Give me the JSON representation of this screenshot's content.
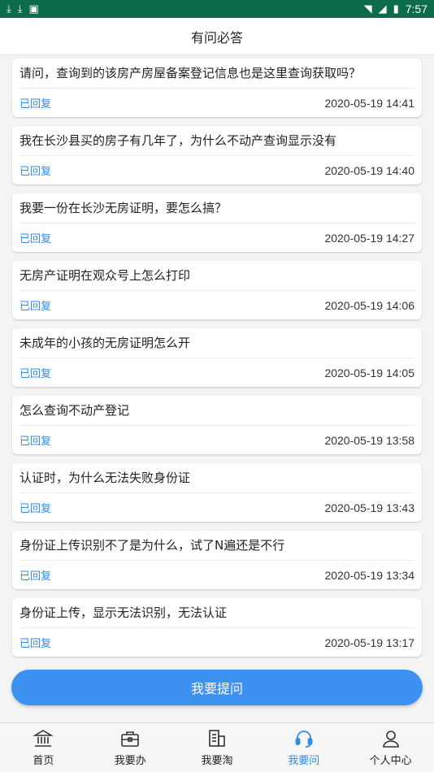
{
  "status_bar": {
    "time": "7:57"
  },
  "header": {
    "title": "有问必答"
  },
  "questions": [
    {
      "question": "请问，查询到的该房产房屋备案登记信息也是这里查询获取吗？",
      "status": "已回复",
      "time": "2020-05-19 14:41"
    },
    {
      "question": "我在长沙县买的房子有几年了，为什么不动产查询显示没有",
      "status": "已回复",
      "time": "2020-05-19 14:40"
    },
    {
      "question": "我要一份在长沙无房证明，要怎么搞？",
      "status": "已回复",
      "time": "2020-05-19 14:27"
    },
    {
      "question": "无房产证明在观众号上怎么打印",
      "status": "已回复",
      "time": "2020-05-19 14:06"
    },
    {
      "question": "未成年的小孩的无房证明怎么开",
      "status": "已回复",
      "time": "2020-05-19 14:05"
    },
    {
      "question": "怎么查询不动产登记",
      "status": "已回复",
      "time": "2020-05-19 13:58"
    },
    {
      "question": "认证时，为什么无法失败身份证",
      "status": "已回复",
      "time": "2020-05-19 13:43"
    },
    {
      "question": "身份证上传识别不了是为什么，试了N遍还是不行",
      "status": "已回复",
      "time": "2020-05-19 13:34"
    },
    {
      "question": "身份证上传，显示无法识别，无法认证",
      "status": "已回复",
      "time": "2020-05-19 13:17"
    }
  ],
  "ask_button": {
    "label": "我要提问"
  },
  "tabs": [
    {
      "label": "首页",
      "icon": "bank-icon"
    },
    {
      "label": "我要办",
      "icon": "briefcase-icon"
    },
    {
      "label": "我要淘",
      "icon": "building-icon"
    },
    {
      "label": "我要问",
      "icon": "headset-icon",
      "active": true
    },
    {
      "label": "个人中心",
      "icon": "person-icon"
    }
  ],
  "colors": {
    "status_bar": "#0c6b48",
    "accent": "#2f8ce8",
    "button": "#3d91f0"
  }
}
